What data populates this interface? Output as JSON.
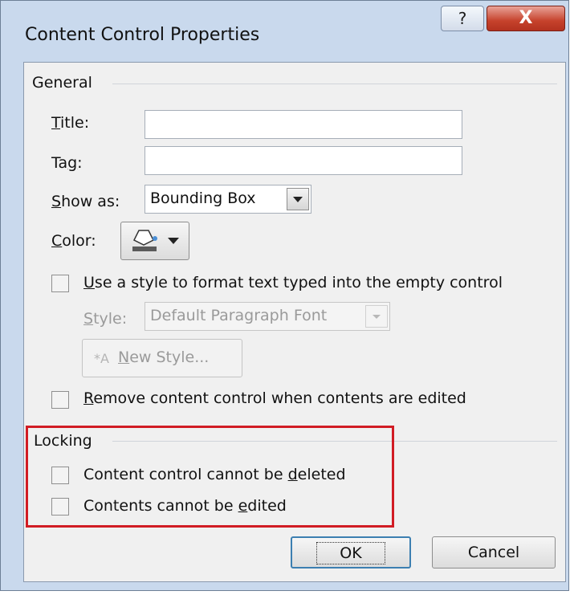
{
  "window": {
    "title": "Content Control Properties",
    "help_glyph": "?",
    "close_glyph": "X"
  },
  "general": {
    "heading": "General",
    "title_label_first": "T",
    "title_label_rest": "itle:",
    "tag_label_pre": "Ta",
    "tag_label_u": "g",
    "tag_label_post": ":",
    "showas_label_pre": "S",
    "showas_label_rest": "how as:",
    "showas_value": "Bounding Box",
    "color_label_first": "C",
    "color_label_rest": "olor:",
    "style_checkbox_first": "U",
    "style_checkbox_rest": "se a style to format text typed into the empty control",
    "style_label_first": "S",
    "style_label_rest": "tyle:",
    "style_value": "Default Paragraph Font",
    "new_style_first": "N",
    "new_style_rest": "ew Style...",
    "remove_checkbox_first": "R",
    "remove_checkbox_rest": "emove content control when contents are edited"
  },
  "locking": {
    "heading": "Locking",
    "cannot_delete_pre": "Content control cannot be ",
    "cannot_delete_u": "d",
    "cannot_delete_post": "eleted",
    "cannot_edit_pre": "Contents cannot be ",
    "cannot_edit_u": "e",
    "cannot_edit_post": "dited"
  },
  "buttons": {
    "ok": "OK",
    "cancel": "Cancel"
  },
  "colors": {
    "highlight": "#d11c24",
    "close_button": "#c6422c"
  }
}
